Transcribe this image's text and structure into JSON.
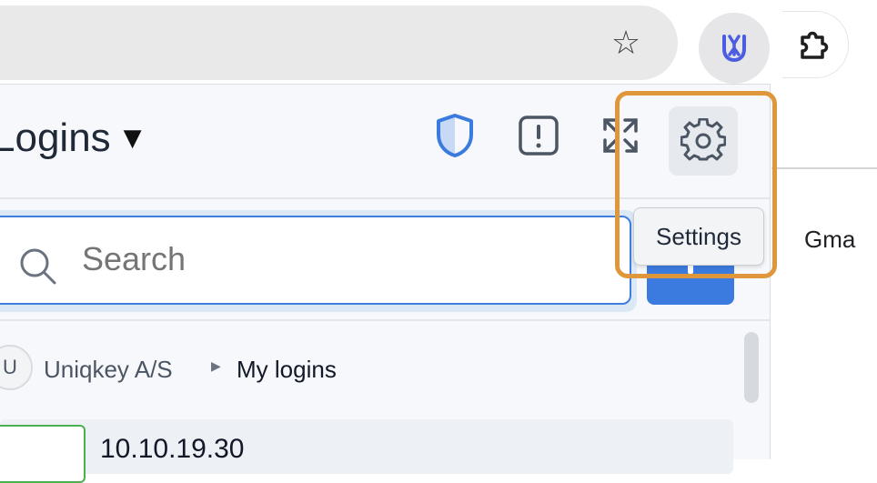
{
  "browser": {
    "star_icon": "star-icon",
    "extension_icon": "uniqkey-extension-icon",
    "puzzle_icon": "extensions-puzzle-icon"
  },
  "popup": {
    "title": "Logins",
    "header_icons": [
      "shield-icon",
      "alert-icon",
      "expand-icon",
      "gear-icon"
    ],
    "tooltip": "Settings",
    "search": {
      "placeholder": "Search"
    },
    "breadcrumb": {
      "avatar_letter": "U",
      "org": "Uniqkey A/S",
      "current": "My logins"
    },
    "list": [
      {
        "title": "10.10.19.30"
      }
    ]
  },
  "page": {
    "partial_text": "Gma"
  },
  "colors": {
    "accent": "#3b7be0",
    "highlight": "#e0963a",
    "shield": "#3b7be0"
  }
}
